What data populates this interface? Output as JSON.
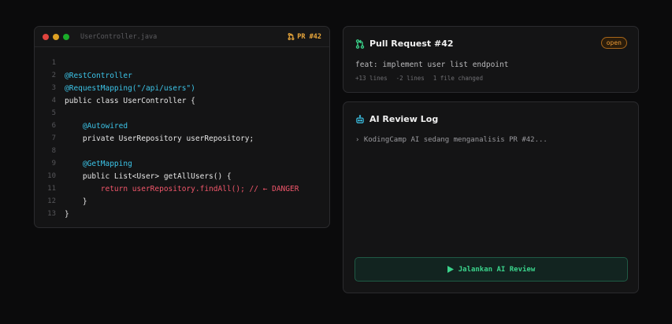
{
  "editor": {
    "filename": "UserController.java",
    "pr_tag": "PR #42",
    "lines": [
      {
        "num": "1",
        "indent": "",
        "text": "",
        "style": "plain"
      },
      {
        "num": "2",
        "indent": "",
        "text": "@RestController",
        "style": "annotation"
      },
      {
        "num": "3",
        "indent": "",
        "text": "@RequestMapping(\"/api/users\")",
        "style": "annotation"
      },
      {
        "num": "4",
        "indent": "",
        "text": "public class UserController {",
        "style": "plain"
      },
      {
        "num": "5",
        "indent": "",
        "text": "",
        "style": "plain"
      },
      {
        "num": "6",
        "indent": "    ",
        "text": "@Autowired",
        "style": "annotation"
      },
      {
        "num": "7",
        "indent": "    ",
        "text": "private UserRepository userRepository;",
        "style": "plain"
      },
      {
        "num": "8",
        "indent": "",
        "text": "",
        "style": "plain"
      },
      {
        "num": "9",
        "indent": "    ",
        "text": "@GetMapping",
        "style": "annotation"
      },
      {
        "num": "10",
        "indent": "    ",
        "text": "public List<User> getAllUsers() {",
        "style": "plain"
      },
      {
        "num": "11",
        "indent": "        ",
        "text": "return userRepository.findAll(); // ← DANGER",
        "style": "danger"
      },
      {
        "num": "12",
        "indent": "    ",
        "text": "}",
        "style": "plain"
      },
      {
        "num": "13",
        "indent": "",
        "text": "}",
        "style": "plain"
      }
    ]
  },
  "pr": {
    "title": "Pull Request #42",
    "status": "open",
    "message": "feat: implement user list endpoint",
    "added": "+13 lines",
    "removed": "-2 lines",
    "files": "1 file changed",
    "icon": "git-pull-request-icon"
  },
  "ai_review": {
    "title": "AI Review Log",
    "icon": "robot-icon",
    "log_prefix": "›",
    "log_text": "KodingCamp AI sedang menganalisis PR #42...",
    "button_label": "Jalankan AI Review"
  },
  "colors": {
    "annotation": "#3cc4e8",
    "danger": "#f0566a",
    "accent_orange": "#e8a63b",
    "accent_green": "#3ad38b",
    "dot_red": "#e0443e",
    "dot_yellow": "#dea123",
    "dot_green": "#1aab29"
  }
}
